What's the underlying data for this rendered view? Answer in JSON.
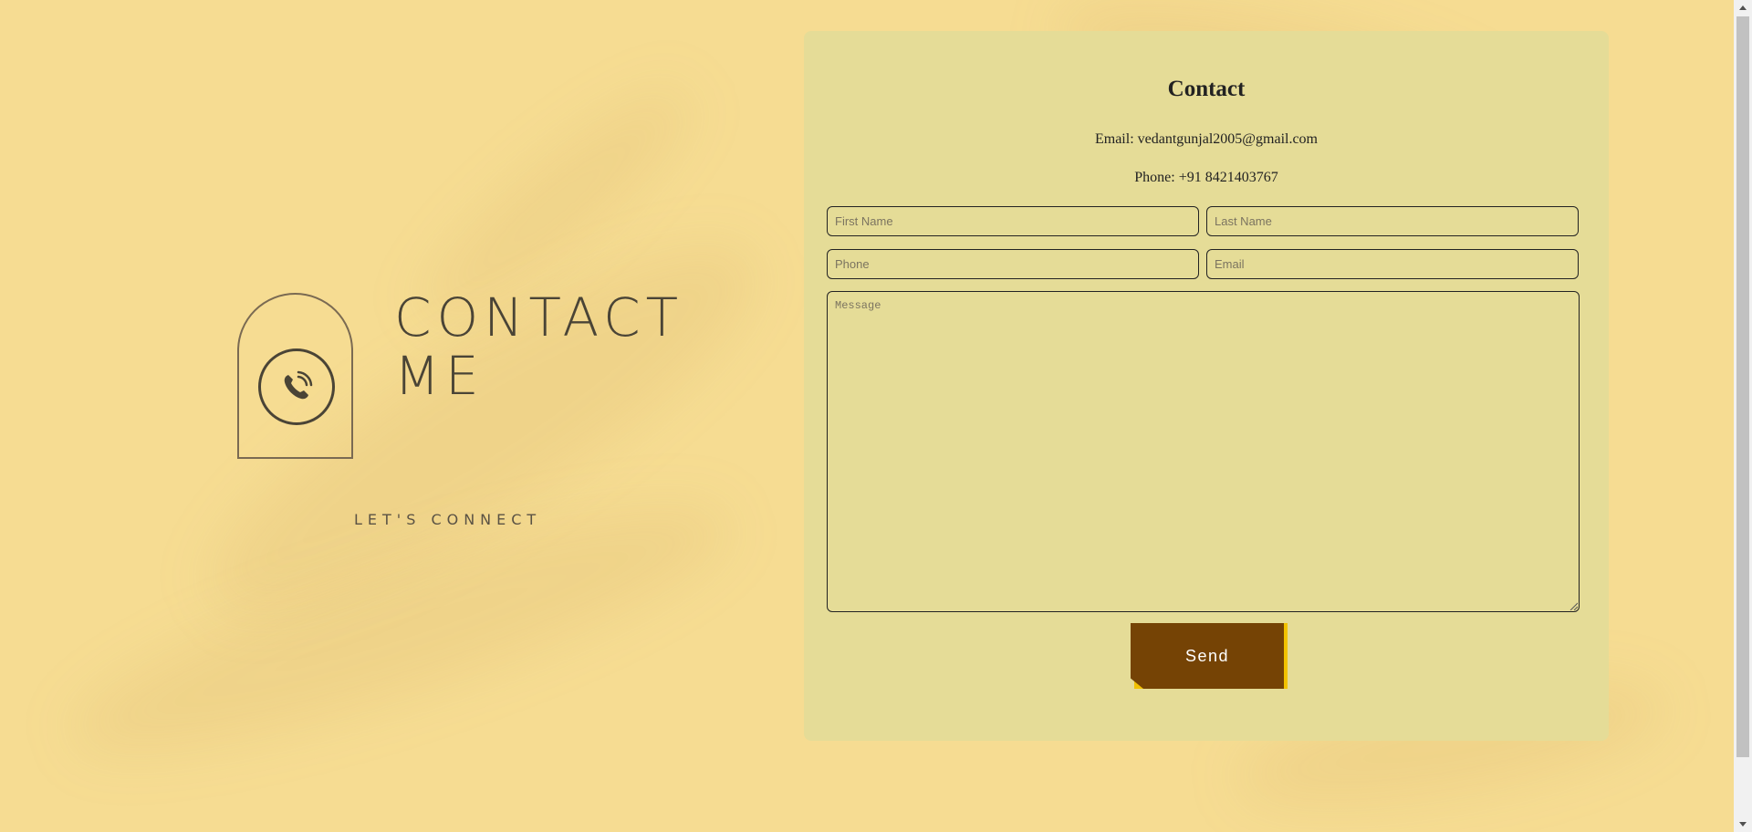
{
  "hero": {
    "title_line1": "CONTACT",
    "title_line2": "ME",
    "subtitle": "LET'S CONNECT",
    "icon": "phone-icon"
  },
  "contact": {
    "heading": "Contact",
    "email_text": "Email: vedantgunjal2005@gmail.com",
    "phone_text": "Phone: +91 8421403767"
  },
  "form": {
    "first_name_placeholder": "First Name",
    "last_name_placeholder": "Last Name",
    "phone_placeholder": "Phone",
    "email_placeholder": "Email",
    "message_placeholder": "Message",
    "send_label": "Send"
  },
  "colors": {
    "page_bg": "#f6dc92",
    "card_bg": "#e5dc97",
    "button_bg": "#754305",
    "button_accent": "#f2c200"
  }
}
